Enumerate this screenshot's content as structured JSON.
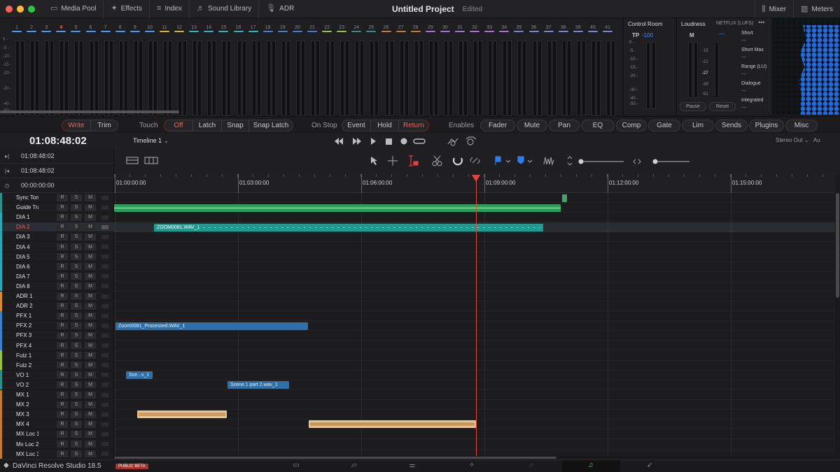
{
  "topbar": {
    "traffic_lights": [
      {
        "color": "#ff5f57"
      },
      {
        "color": "#febc2e"
      },
      {
        "color": "#28c840"
      }
    ],
    "items": [
      {
        "label": "Media Pool",
        "icon": "media-pool-icon"
      },
      {
        "label": "Effects",
        "icon": "effects-icon"
      },
      {
        "label": "Index",
        "icon": "index-icon"
      },
      {
        "label": "Sound Library",
        "icon": "sound-library-icon"
      },
      {
        "label": "ADR",
        "icon": "adr-icon"
      }
    ],
    "project_title": "Untitled Project",
    "project_status": "Edited",
    "right_items": [
      {
        "label": "Mixer",
        "icon": "mixer-icon"
      },
      {
        "label": "Meters",
        "icon": "meters-icon"
      }
    ]
  },
  "meters": {
    "channels": [
      "1",
      "2",
      "3",
      "4",
      "5",
      "6",
      "7",
      "8",
      "9",
      "10",
      "11",
      "12",
      "13",
      "14",
      "15",
      "16",
      "17",
      "18",
      "19",
      "20",
      "21",
      "22",
      "23",
      "24",
      "25",
      "26",
      "27",
      "28",
      "29",
      "30",
      "31",
      "32",
      "33",
      "34",
      "35",
      "36",
      "37",
      "38",
      "39",
      "40",
      "41"
    ],
    "selected_channel": "4",
    "db_scale": [
      "0 -",
      "-5 -",
      "-10 -",
      "-15 -",
      "-20 -",
      "-30 -",
      "-40 -",
      "-50 -"
    ]
  },
  "control_room": {
    "title": "Control Room",
    "tp_label": "TP",
    "tp_value": "-100",
    "scale": [
      "0 -",
      "-5 -",
      "-10 -",
      "-15 -",
      "-20 -",
      "-30 -",
      "-40 -",
      "-50 -"
    ]
  },
  "loudness": {
    "title": "Loudness",
    "standard": "NETFLIX (LUFS)",
    "m_label": "M",
    "m_value": "—",
    "scale": [
      "-15",
      "-21",
      "-27",
      "-39",
      "-51"
    ],
    "stats": [
      {
        "label": "Short",
        "value": "—"
      },
      {
        "label": "Short Max",
        "value": "—"
      },
      {
        "label": "Range (LU)",
        "value": "—"
      },
      {
        "label": "Dialogue",
        "value": "—"
      },
      {
        "label": "Integrated",
        "value": "—"
      }
    ],
    "pause": "Pause",
    "reset": "Reset"
  },
  "automation": {
    "write": "Write",
    "trim": "Trim",
    "touch_label": "Touch",
    "touch_modes": [
      "Off",
      "Latch",
      "Snap",
      "Snap Latch"
    ],
    "onstop_label": "On Stop",
    "onstop_modes": [
      "Event",
      "Hold",
      "Return"
    ],
    "enables_label": "Enables",
    "enables": [
      "Fader",
      "Mute",
      "Pan",
      "EQ",
      "Comp",
      "Gate",
      "Lim",
      "Sends",
      "Plugins",
      "Misc"
    ]
  },
  "transport": {
    "timecode": "01:08:48:02",
    "timeline_name": "Timeline 1",
    "output": "Stereo Out",
    "output_extra": "Au"
  },
  "timecodes": {
    "t1": "01:08:48:02",
    "t2": "01:08:48:02",
    "t3": "00:00:00:00"
  },
  "ruler": [
    "01:00:00:00",
    "01:03:00:00",
    "01:06:00:00",
    "01:09:00:00",
    "01:12:00:00",
    "01:15:00:00"
  ],
  "tracks": [
    {
      "name": "Sync Tone",
      "color": "#2e8f8a"
    },
    {
      "name": "Guide Track",
      "color": "#2e8f8a"
    },
    {
      "name": "DIA 1",
      "color": "#2aa8b8"
    },
    {
      "name": "DIA 2",
      "color": "#2aa8b8",
      "selected": true
    },
    {
      "name": "DIA 3",
      "color": "#2aa8b8"
    },
    {
      "name": "DIA 4",
      "color": "#2aa8b8"
    },
    {
      "name": "DIA 5",
      "color": "#2aa8b8"
    },
    {
      "name": "DIA 6",
      "color": "#2aa8b8"
    },
    {
      "name": "DIA 7",
      "color": "#2aa8b8"
    },
    {
      "name": "DIA 8",
      "color": "#2aa8b8"
    },
    {
      "name": "ADR 1",
      "color": "#d98a2b"
    },
    {
      "name": "ADR 2",
      "color": "#d98a2b"
    },
    {
      "name": "PFX 1",
      "color": "#3b7fd1"
    },
    {
      "name": "PFX 2",
      "color": "#3b7fd1"
    },
    {
      "name": "PFX 3",
      "color": "#3b7fd1"
    },
    {
      "name": "PFX 4",
      "color": "#3b7fd1"
    },
    {
      "name": "Futz 1",
      "color": "#9ac23a"
    },
    {
      "name": "Futz 2",
      "color": "#9ac23a"
    },
    {
      "name": "VO 1",
      "color": "#2e8f8a"
    },
    {
      "name": "VO 2",
      "color": "#2e8f8a"
    },
    {
      "name": "MX 1",
      "color": "#c87a2b"
    },
    {
      "name": "MX 2",
      "color": "#c87a2b"
    },
    {
      "name": "MX 3",
      "color": "#c87a2b"
    },
    {
      "name": "MX 4",
      "color": "#c87a2b"
    },
    {
      "name": "MX Loc 1",
      "color": "#c87a2b"
    },
    {
      "name": "Mx Loc 2",
      "color": "#c87a2b"
    },
    {
      "name": "MX Loc 3",
      "color": "#c87a2b"
    }
  ],
  "clips": [
    {
      "name": "ZOOM0081.WAV_1",
      "color": "#1f9a8f"
    },
    {
      "name": "Zoom0081_Processed.WAV_1",
      "color": "#2d6fa8"
    },
    {
      "name": "Sce...v_1",
      "color": "#2d6fa8"
    },
    {
      "name": "Scene 1 part 2.wav_1",
      "color": "#2d6fa8"
    }
  ],
  "bottombar": {
    "app_name": "DaVinci Resolve Studio 18.5",
    "badge": "PUBLIC BETA",
    "pages": [
      {
        "icon": "media-page-icon"
      },
      {
        "icon": "cut-page-icon"
      },
      {
        "icon": "edit-page-icon"
      },
      {
        "icon": "fusion-page-icon"
      },
      {
        "icon": "color-page-icon"
      },
      {
        "icon": "fairlight-page-icon",
        "active": true
      },
      {
        "icon": "deliver-page-icon"
      }
    ]
  }
}
